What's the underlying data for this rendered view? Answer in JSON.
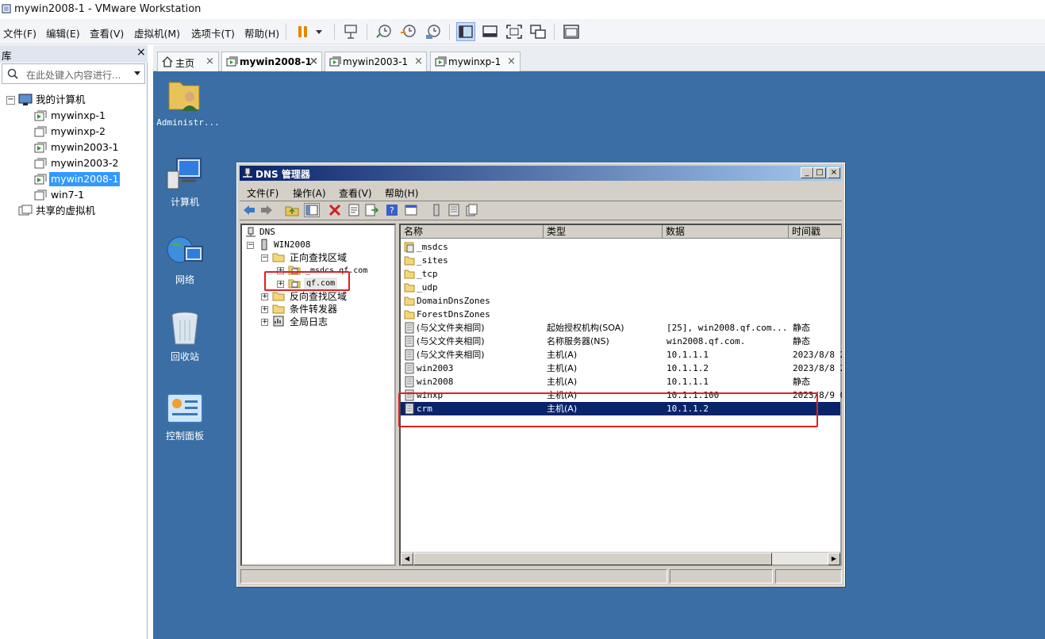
{
  "app": {
    "window_title": "mywin2008-1 - VMware Workstation",
    "menu": [
      "文件(F)",
      "编辑(E)",
      "查看(V)",
      "虚拟机(M)",
      "选项卡(T)",
      "帮助(H)"
    ]
  },
  "library": {
    "title": "库",
    "close": "×",
    "search_placeholder": "在此处键入内容进行...",
    "root": "我的计算机",
    "vms": [
      "mywinxp-1",
      "mywinxp-2",
      "mywin2003-1",
      "mywin2003-2",
      "mywin2008-1",
      "win7-1"
    ],
    "selected_vm": "mywin2008-1",
    "shared": "共享的虚拟机"
  },
  "tabs": [
    {
      "label": "主页",
      "active": false
    },
    {
      "label": "mywin2008-1",
      "active": true
    },
    {
      "label": "mywin2003-1",
      "active": false
    },
    {
      "label": "mywinxp-1",
      "active": false
    }
  ],
  "tab_close": "×",
  "desktop": {
    "icons": [
      "Administr...",
      "计算机",
      "网络",
      "回收站",
      "控制面板"
    ]
  },
  "dns": {
    "title": "DNS 管理器",
    "menu": [
      "文件(F)",
      "操作(A)",
      "查看(V)",
      "帮助(H)"
    ],
    "tree": {
      "root": "DNS",
      "server": "WIN2008",
      "forward": "正向查找区域",
      "msdcs": "_msdcs.qf.com",
      "qf": "qf.com",
      "reverse": "反向查找区域",
      "conditional": "条件转发器",
      "globallog": "全局日志"
    },
    "columns": [
      "名称",
      "类型",
      "数据",
      "时间戳"
    ],
    "rows": [
      {
        "name": "_msdcs",
        "type": "",
        "data": "",
        "ts": "",
        "icon": "folder-db"
      },
      {
        "name": "_sites",
        "type": "",
        "data": "",
        "ts": "",
        "icon": "folder"
      },
      {
        "name": "_tcp",
        "type": "",
        "data": "",
        "ts": "",
        "icon": "folder"
      },
      {
        "name": "_udp",
        "type": "",
        "data": "",
        "ts": "",
        "icon": "folder"
      },
      {
        "name": "DomainDnsZones",
        "type": "",
        "data": "",
        "ts": "",
        "icon": "folder"
      },
      {
        "name": "ForestDnsZones",
        "type": "",
        "data": "",
        "ts": "",
        "icon": "folder"
      },
      {
        "name": "(与父文件夹相同)",
        "type": "起始授权机构(SOA)",
        "data": "[25], win2008.qf.com....",
        "ts": "静态",
        "icon": "record"
      },
      {
        "name": "(与父文件夹相同)",
        "type": "名称服务器(NS)",
        "data": "win2008.qf.com.",
        "ts": "静态",
        "icon": "record"
      },
      {
        "name": "(与父文件夹相同)",
        "type": "主机(A)",
        "data": "10.1.1.1",
        "ts": "2023/8/8 2",
        "icon": "record"
      },
      {
        "name": "win2003",
        "type": "主机(A)",
        "data": "10.1.1.2",
        "ts": "2023/8/8 2",
        "icon": "record"
      },
      {
        "name": "win2008",
        "type": "主机(A)",
        "data": "10.1.1.1",
        "ts": "静态",
        "icon": "record"
      },
      {
        "name": "winxp",
        "type": "主机(A)",
        "data": "10.1.1.100",
        "ts": "2023/8/9 0",
        "icon": "record"
      },
      {
        "name": "crm",
        "type": "主机(A)",
        "data": "10.1.1.2",
        "ts": "",
        "icon": "record"
      }
    ],
    "selected_row": 12
  }
}
